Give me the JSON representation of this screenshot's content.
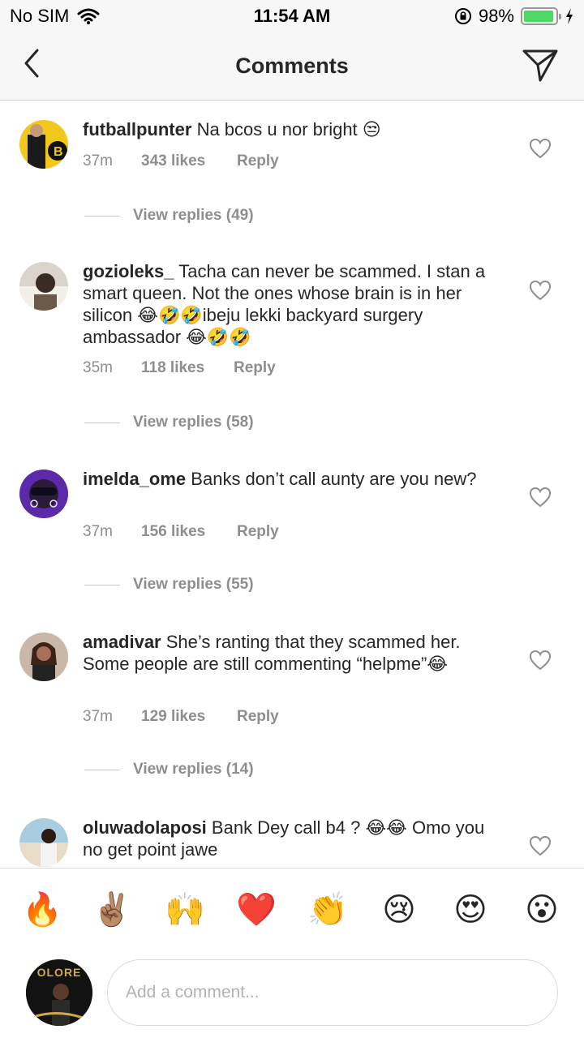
{
  "status_bar": {
    "carrier": "No SIM",
    "time": "11:54 AM",
    "battery": "98%",
    "battery_level": 0.98
  },
  "header": {
    "title": "Comments"
  },
  "comments": [
    {
      "username": "futballpunter",
      "text": "Na bcos u nor bright 😒",
      "time": "37m",
      "likes": "343 likes",
      "reply": "Reply",
      "view_replies": "View replies (49)",
      "avatar_color": "#f2c81c"
    },
    {
      "username": "gozioleks_",
      "text": "Tacha can never be scammed. I stan a smart queen. Not the ones whose brain is in her silicon 😂🤣🤣ibeju lekki backyard surgery ambassador 😂🤣🤣",
      "time": "35m",
      "likes": "118 likes",
      "reply": "Reply",
      "view_replies": "View replies (58)",
      "avatar_color": "#6b5a4a"
    },
    {
      "username": "imelda_ome",
      "text": "Banks don’t call aunty are you new?",
      "time": "37m",
      "likes": "156 likes",
      "reply": "Reply",
      "view_replies": "View replies (55)",
      "avatar_color": "#7a3fd6"
    },
    {
      "username": "amadivar",
      "text": "She’s ranting that they scammed her. Some people are still commenting “helpme”😂",
      "time": "37m",
      "likes": "129 likes",
      "reply": "Reply",
      "view_replies": "View replies (14)",
      "avatar_color": "#9a6a58"
    },
    {
      "username": "oluwadolaposi",
      "text": "Bank Dey call b4 ? 😂😂 Omo you no get point jawe",
      "avatar_color": "#8fb4c8"
    }
  ],
  "emoji_bar": [
    "🔥",
    "✌🏽",
    "🙌",
    "❤️",
    "👏",
    "😢",
    "😍",
    "😮"
  ],
  "composer": {
    "placeholder": "Add a comment...",
    "avatar_text": "OLORE"
  }
}
